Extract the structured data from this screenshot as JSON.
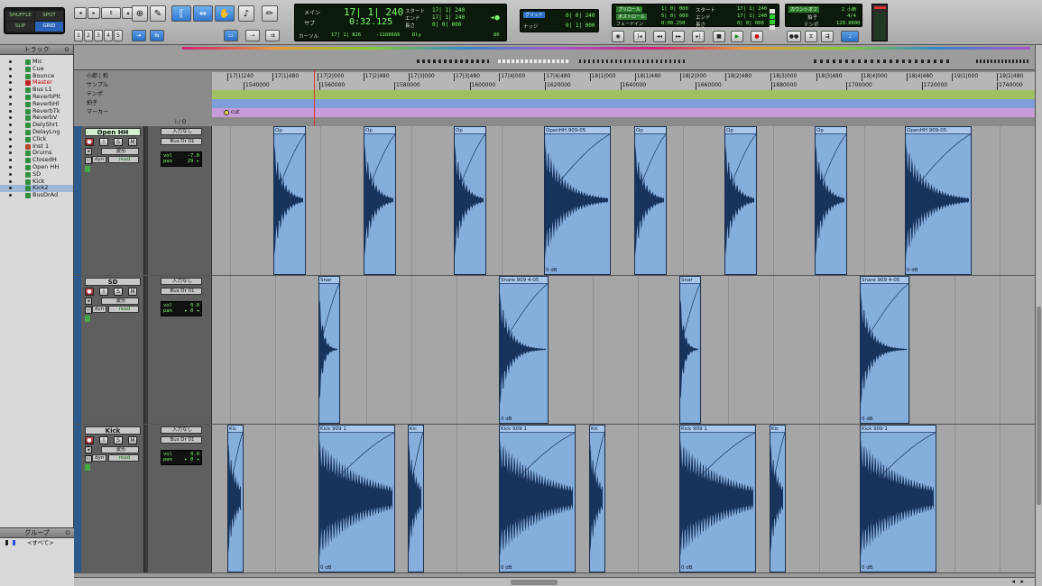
{
  "toolbar": {
    "mode_buttons": [
      "SHUFFLE",
      "SPOT",
      "SLIP",
      "GRID"
    ],
    "zoom_presets": [
      "1",
      "2",
      "3",
      "4",
      "5"
    ],
    "counter": {
      "main_label": "メイン",
      "main_value": "17| 1| 240",
      "sub_label": "サブ",
      "sub_value": "0:32.125",
      "cursor_label": "カーソル",
      "cursor_value": "17| 1| 826",
      "cursor_sample": "-1166666",
      "start_label": "スタート",
      "start_value": "17| 1| 240",
      "end_label": "エンド",
      "end_value": "17| 1| 240",
      "len_label": "長さ",
      "len_value": "0| 0| 000",
      "nudge": "80",
      "dly": "Dly"
    },
    "grid": {
      "label_grid": "グリッド",
      "grid_value": "0| 0| 240",
      "label_nudge": "ナッジ",
      "nudge_value": "0| 1| 000"
    },
    "transport": {
      "preroll_label": "プリロール",
      "postroll_label": "ポストロール",
      "fade_label": "フェードイン",
      "preroll": "1| 0| 000",
      "postroll": "5| 0| 000",
      "fadein": "0:00.250",
      "start_label": "スタート",
      "end_label": "エンド",
      "len_label": "長さ",
      "start": "17| 1| 240",
      "end": "17| 1| 240",
      "len": "0| 0| 000"
    },
    "tempo": {
      "countoff_label": "カウントオフ",
      "countoff_value": "2 小節",
      "meter_label": "拍子",
      "meter_value": "4/4",
      "tempo_label": "テンポ",
      "tempo_value": "120.0000"
    }
  },
  "tracks_panel": {
    "title": "トラック",
    "items": [
      "Mic",
      "Cue",
      "Bounce",
      "Master",
      "Bus L1",
      "ReverbPlt",
      "ReverbHl",
      "ReverbTk",
      "ReverbV",
      "DelyShrt",
      "DelayLng",
      "Click",
      "Inst 1",
      "Drums",
      "ClosedH",
      "Open HH",
      "SD",
      "Kick",
      "Kick2",
      "BusDrAd"
    ]
  },
  "groups_panel": {
    "title": "グループ",
    "all_label": "<すべて>"
  },
  "rulers": {
    "bars_label": "小節 | 拍",
    "samples_label": "サンプル",
    "tempo_label": "テンポ",
    "meter_label": "拍子",
    "marker_label": "マーカー",
    "marker_text": "cut",
    "io_label": "I / O",
    "bar_ticks": [
      "17|1|240",
      "17|1|480",
      "17|2|000",
      "17|2|480",
      "17|3|000",
      "17|3|480",
      "17|4|000",
      "17|4|480",
      "18|1|000",
      "18|1|480",
      "18|2|000",
      "18|2|480",
      "18|3|000",
      "18|3|480",
      "18|4|000",
      "18|4|480",
      "19|1|000",
      "19|1|480"
    ],
    "sample_ticks": [
      "1540000",
      "1560000",
      "1580000",
      "1600000",
      "1620000",
      "1640000",
      "1660000",
      "1680000",
      "1700000",
      "1720000",
      "1740000"
    ]
  },
  "tracks": [
    {
      "name": "Open HH",
      "input": "入力なし",
      "output": "Bus Dr 01",
      "mode": "波形",
      "dyn": "dyn",
      "auto": "read",
      "vol_label": "vol",
      "vol": "-7.0",
      "pan_label": "pan",
      "pan": "29 ▸",
      "clips": [
        {
          "label": "Op",
          "gain": ""
        },
        {
          "label": "Op",
          "gain": ""
        },
        {
          "label": "Op",
          "gain": ""
        },
        {
          "label": "OpenHH 909-05",
          "gain": "0 dB"
        },
        {
          "label": "Op",
          "gain": ""
        },
        {
          "label": "Op",
          "gain": ""
        },
        {
          "label": "Op",
          "gain": ""
        },
        {
          "label": "OpenHH 909-05",
          "gain": "0 dB"
        }
      ]
    },
    {
      "name": "SD",
      "input": "入力なし",
      "output": "Bus Dr 01",
      "mode": "波形",
      "dyn": "dyn",
      "auto": "read",
      "vol_label": "vol",
      "vol": "0.0",
      "pan_label": "pan",
      "pan": "▸ 0 ◂",
      "clips": [
        {
          "label": "Snar",
          "gain": ""
        },
        {
          "label": "Snare 909 4-05",
          "gain": "0 dB"
        },
        {
          "label": "Snar",
          "gain": ""
        },
        {
          "label": "Snare 909 4-05",
          "gain": "0 dB"
        }
      ]
    },
    {
      "name": "Kick",
      "input": "入力なし",
      "output": "Bus Dr 01",
      "mode": "波形",
      "dyn": "dyn",
      "auto": "read",
      "vol_label": "vol",
      "vol": "0.0",
      "pan_label": "pan",
      "pan": "▸ 0 ◂",
      "clips": [
        {
          "label": "Kic",
          "gain": ""
        },
        {
          "label": "Kick 909 1",
          "gain": "0 dB"
        },
        {
          "label": "Kic",
          "gain": ""
        },
        {
          "label": "Kick 909 1",
          "gain": "0 dB"
        },
        {
          "label": "Kic",
          "gain": ""
        },
        {
          "label": "Kick 909 1",
          "gain": "0 dB"
        },
        {
          "label": "Kic",
          "gain": ""
        },
        {
          "label": "Kick 909 1",
          "gain": "0 dB"
        }
      ]
    }
  ],
  "icons": {
    "solo": "S",
    "mute": "M",
    "input": "I",
    "rec": "●"
  }
}
